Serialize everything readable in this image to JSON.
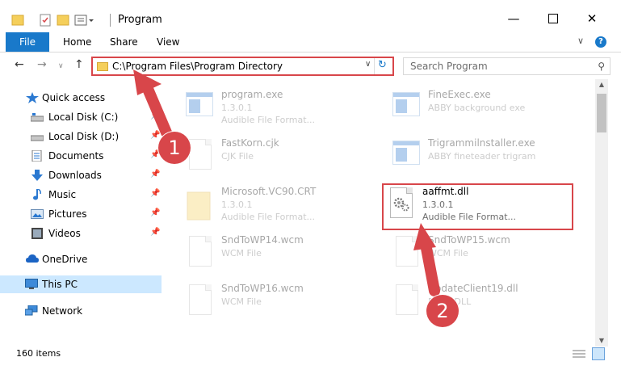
{
  "window": {
    "title": "Program",
    "minimize_icon": "minimize-icon",
    "maximize_icon": "maximize-icon",
    "close_icon": "close-icon"
  },
  "ribbon": {
    "tabs": [
      "File",
      "Home",
      "Share",
      "View"
    ],
    "accent": "#1979ca"
  },
  "address": {
    "path": "C:\\Program Files\\Program Directory"
  },
  "search": {
    "placeholder": "Search Program"
  },
  "sidebar": {
    "items": [
      {
        "label": "Quick access",
        "icon": "star-icon"
      },
      {
        "label": "Local Disk (C:)",
        "icon": "disk-icon",
        "pinned": true
      },
      {
        "label": "Local Disk (D:)",
        "icon": "disk-icon",
        "pinned": true
      },
      {
        "label": "Documents",
        "icon": "documents-icon",
        "pinned": true
      },
      {
        "label": "Downloads",
        "icon": "downloads-icon",
        "pinned": true
      },
      {
        "label": "Music",
        "icon": "music-icon",
        "pinned": true
      },
      {
        "label": "Pictures",
        "icon": "pictures-icon",
        "pinned": true
      },
      {
        "label": "Videos",
        "icon": "videos-icon",
        "pinned": true
      },
      {
        "label": "OneDrive",
        "icon": "onedrive-icon"
      },
      {
        "label": "This PC",
        "icon": "pc-icon",
        "selected": true
      },
      {
        "label": "Network",
        "icon": "network-icon"
      }
    ]
  },
  "files": [
    {
      "name": "program.exe",
      "line2": "1.3.0.1",
      "line3": "Audible File Format..."
    },
    {
      "name": "FineExec.exe",
      "line2": "ABBY background exe",
      "line3": ""
    },
    {
      "name": "FastKorn.cjk",
      "line2": "CJK File",
      "line3": ""
    },
    {
      "name": "Trigrammilnstaller.exe",
      "line2": "ABBY fineteader trigram",
      "line3": ""
    },
    {
      "name": "Microsoft.VC90.CRT",
      "line2": "1.3.0.1",
      "line3": "Audible File Format..."
    },
    {
      "name": "aaffmt.dll",
      "line2": "1.3.0.1",
      "line3": "Audible File Format..."
    },
    {
      "name": "SndToWP14.wcm",
      "line2": "WCM File",
      "line3": ""
    },
    {
      "name": "SndToWP15.wcm",
      "line2": "WCM File",
      "line3": ""
    },
    {
      "name": "SndToWP16.wcm",
      "line2": "WCM File",
      "line3": ""
    },
    {
      "name": "UpdateClient19.dll",
      "line2": "Fidoe DLL",
      "line3": ""
    }
  ],
  "status": {
    "count": "160 items"
  },
  "annotations": [
    "1",
    "2"
  ],
  "highlight_color": "#d8464a"
}
